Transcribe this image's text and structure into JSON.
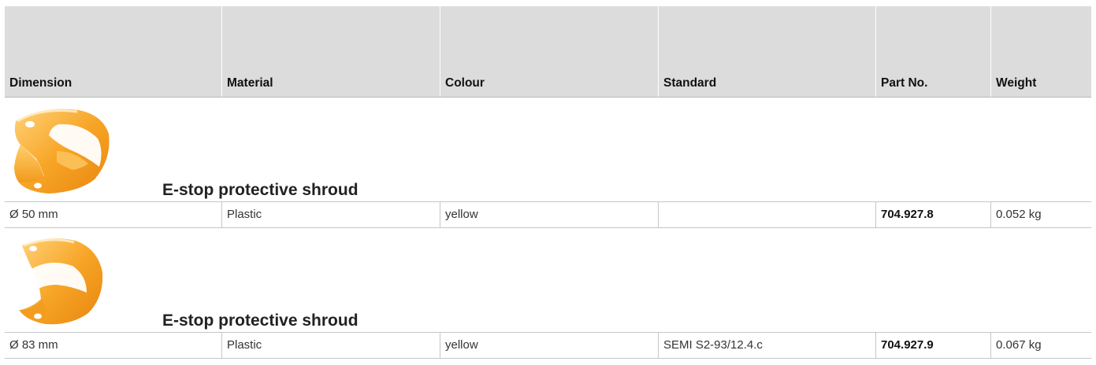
{
  "table": {
    "headers": [
      "Dimension",
      "Material",
      "Colour",
      "Standard",
      "Part No.",
      "Weight"
    ],
    "products": [
      {
        "title": "E-stop protective shroud",
        "image": "yellow-shroud-50mm",
        "row": {
          "dimension": "Ø 50 mm",
          "material": "Plastic",
          "colour": "yellow",
          "standard": "",
          "part_no": "704.927.8",
          "weight": "0.052 kg"
        }
      },
      {
        "title": "E-stop protective shroud",
        "image": "yellow-shroud-83mm",
        "row": {
          "dimension": "Ø 83 mm",
          "material": "Plastic",
          "colour": "yellow",
          "standard": "SEMI S2-93/12.4.c",
          "part_no": "704.927.9",
          "weight": "0.067 kg"
        }
      }
    ]
  },
  "colors": {
    "header_bg": "#dcdcdc",
    "product_yellow": "#f5a623",
    "border": "#c6c6c6"
  }
}
